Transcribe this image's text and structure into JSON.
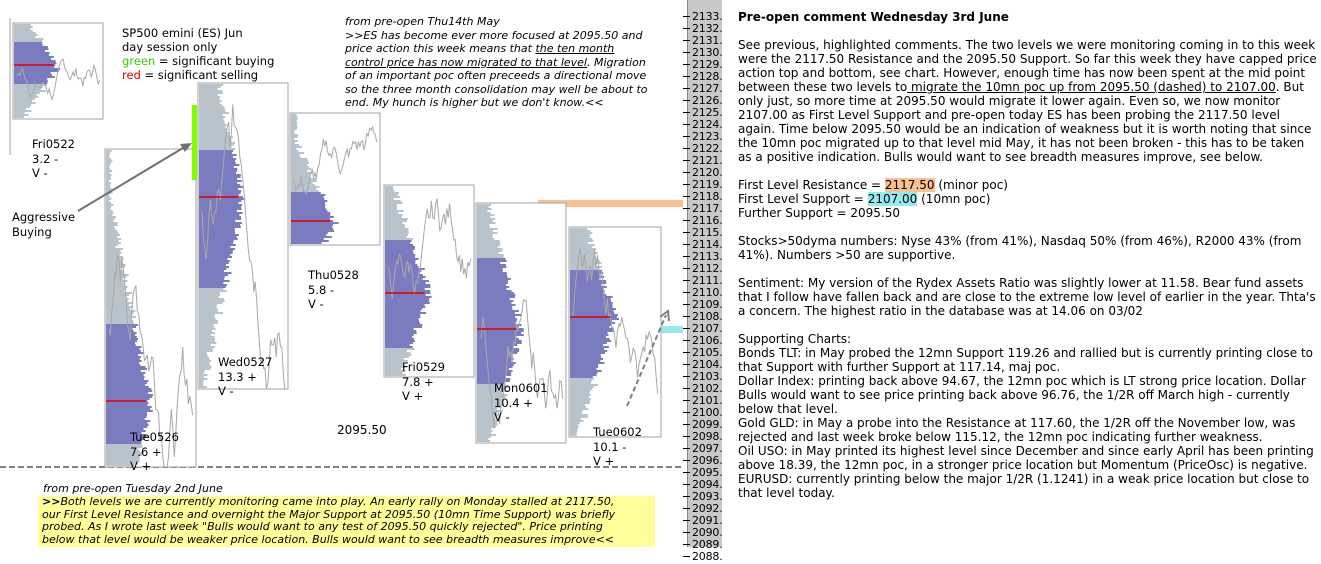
{
  "chart_data": {
    "type": "market-profile",
    "title": "SP500 emini (ES) Jun day session only",
    "legend": [
      {
        "label": "green = significant buying",
        "color": "#33cc00"
      },
      {
        "label": "red = significant selling",
        "color": "#e00000"
      }
    ],
    "y_axis": {
      "range": [
        2088,
        2133
      ],
      "tick_labels": [
        "2133.",
        "2132.",
        "2131.",
        "2130.",
        "2129.",
        "2128.",
        "2127.",
        "2126.",
        "2125.",
        "2124.",
        "2123.",
        "2122.",
        "2121.",
        "2120.",
        "2119.",
        "2118.",
        "2117.",
        "2116.",
        "2115.",
        "2114.",
        "2113.",
        "2112.",
        "2111.",
        "2110.",
        "2109.",
        "2108.",
        "2107.",
        "2106.",
        "2105.",
        "2104.",
        "2103.",
        "2102.",
        "2101.",
        "2100.",
        "2099.",
        "2098.",
        "2097.",
        "2096.",
        "2095.",
        "2094.",
        "2093.",
        "2092.",
        "2091.",
        "2090.",
        "2089.",
        "2088."
      ]
    },
    "levels": [
      {
        "name": "First Level Resistance",
        "value": 2117.5,
        "color": "#fac090"
      },
      {
        "name": "First Level Support",
        "value": 2107.0,
        "color": "#93eaf0"
      },
      {
        "name": "Major Support (dashed)",
        "value": 2095.5,
        "label": "2095.50",
        "color": "#808080"
      }
    ],
    "sessions": [
      {
        "day": "Fri0522",
        "range_value": "3.2 -",
        "volume": "V -",
        "high": 2132.5,
        "low": 2124.5,
        "poc": 2129.0,
        "va_high": 2131.0,
        "va_low": 2127.5
      },
      {
        "day": "Tue0526",
        "range_value": "7.6 +",
        "volume": "V +",
        "high": 2122.0,
        "low": 2095.5,
        "poc": 2101.0,
        "va_high": 2107.5,
        "va_low": 2097.5
      },
      {
        "day": "Wed0527",
        "range_value": "13.3 +",
        "volume": "V -",
        "high": 2127.5,
        "low": 2102.0,
        "poc": 2118.0,
        "va_high": 2122.0,
        "va_low": 2110.5
      },
      {
        "day": "Thu0528",
        "range_value": "5.8 -",
        "volume": "V -",
        "high": 2125.0,
        "low": 2114.0,
        "poc": 2116.0,
        "va_high": 2118.5,
        "va_low": 2114.0
      },
      {
        "day": "Fri0529",
        "range_value": "7.8 +",
        "volume": "V +",
        "high": 2119.0,
        "low": 2103.0,
        "poc": 2110.0,
        "va_high": 2114.5,
        "va_low": 2105.5
      },
      {
        "day": "Mon0601",
        "range_value": "10.4 +",
        "volume": "V -",
        "high": 2117.5,
        "low": 2097.5,
        "poc": 2107.0,
        "va_high": 2113.0,
        "va_low": 2102.5
      },
      {
        "day": "Tue0602",
        "range_value": "10.1 -",
        "volume": "V +",
        "high": 2115.5,
        "low": 2098.0,
        "poc": 2108.0,
        "va_high": 2112.0,
        "va_low": 2103.0
      }
    ],
    "annotations": [
      "Aggressive Buying"
    ]
  },
  "legend_text": {
    "line1": "SP500 emini  (ES)  Jun",
    "line2": "day session only",
    "green_word": "green",
    "green_rest": " = significant buying",
    "red_word": "red",
    "red_rest": " = significant selling"
  },
  "annotation_aggressive": {
    "line1": "Aggressive",
    "line2": "Buying"
  },
  "dashed_level_label": "2095.50",
  "quote_top": {
    "head": "from pre-open Thu14th May",
    "l1": ">>ES has become ever more focused at 2095.50 and",
    "l2a": "price action this week means that ",
    "l2u": "the ten month ",
    "l3u": "control price has now migrated to that level",
    "l3b": ".  Migration",
    "l4": "of an important poc often preceeds a directional move",
    "l5": "so the three month consolidation may well be about to",
    "l6": "end.  My hunch is higher but we don't know.<<"
  },
  "quote_bottom": {
    "head": "from pre-open Tuesday 2nd June",
    "prefix": ">>",
    "l1": "Both levels we are currently monitoring came into play.  An early rally on Monday stalled at  2117.50,",
    "l2": "our First Level Resistance and overnight the Major Support at 2095.50 (10mn Time Support) was briefly",
    "l3": "probed.  As I wrote last week \"Bulls would want to any test of 2095.50 quickly rejected\".  Price printing",
    "l4": "below that level would be weaker price location.  Bulls would want to see breadth measures improve<<"
  },
  "comment": {
    "title": "Pre-open comment Wednesday 3rd June",
    "p1a": "See previous, highlighted comments.  The two levels we were monitoring coming in to this week were the 2117.50 Resistance and the  2095.50 Support.  So far this week they have capped price action top and bottom, see chart.  However, enough time has now been spent at the mid point between these two levels to",
    "p1u": " migrate the 10mn poc up from 2095.50 (dashed) to 2107.00",
    "p1b": ".  But only just, so more time at 2095.50 would migrate it lower again.  Even so, we now monitor 2107.00 as First Level Support and pre-open today ES has been probing the 2117.50 level again.  Time below 2095.50 would be an indication of weakness but it is worth noting that since the 10mn  poc migrated up to that level mid May, it has not been broken - this has to be taken as a positive indication.  Bulls would want to see breadth measures improve, see below.",
    "levels": {
      "r_label": "First Level Resistance = ",
      "r_value": "2117.50",
      "r_note": " (minor poc)",
      "s_label": "First Level Support = ",
      "s_value": "2107.00",
      "s_note": " (10mn poc)",
      "f_label": "Further Support = 2095.50"
    },
    "breadth": "Stocks>50dyma numbers: Nyse 43% (from 41%), Nasdaq 50% (from 46%), R2000 43% (from 41%).  Numbers >50 are supportive.",
    "sentiment": "Sentiment:  My version of the Rydex Assets Ratio was slightly lower at 11.58.   Bear fund assets that I follow have fallen back and are close to the extreme low level of earlier in the year.  Thta's a concern. The highest ratio in the database was at 14.06 on 03/02",
    "supporting_title": "Supporting Charts:",
    "supporting": [
      "Bonds TLT: in May probed the 12mn Support 119.26 and rallied but is currently printing close to that Support with further Support at 117.14, maj poc.",
      "Dollar Index: printing back above 94.67, the 12mn poc which is LT strong price location. Dollar Bulls would want to see price printing back above 96.76, the 1/2R off March high - currently below that level.",
      "Gold GLD: in May a probe into the Resistance at 117.60, the 1/2R off the November low, was rejected and last week broke below 115.12, the 12mn poc indicating further weakness.",
      "Oil USO: in May printed its highest level since December and since early April has been printing above 18.39, the 12mn poc, in a stronger price location but Momentum (PriceOsc) is negative.",
      "EURUSD: currently printing below the major 1/2R (1.1241) in a weak price location but close to that level today."
    ]
  }
}
